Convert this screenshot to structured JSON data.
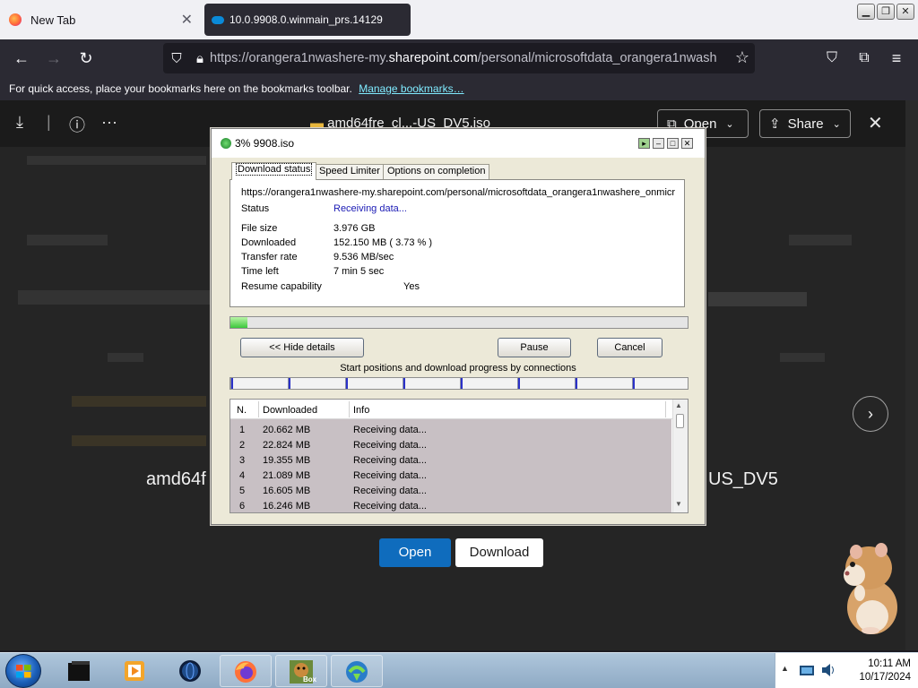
{
  "browser": {
    "tabs": [
      {
        "label": "New Tab"
      },
      {
        "label": "10.0.9908.0.winmain_prs.14129"
      }
    ],
    "url": {
      "prefix": "https://orangera1nwashere-my.",
      "domain": "sharepoint.com",
      "suffix": "/personal/microsoftdata_orangera1nwashere_"
    },
    "bookmarks_bar": {
      "text": "For quick access, place your bookmarks here on the bookmarks toolbar.",
      "link": "Manage bookmarks…"
    },
    "window_controls": [
      "minimize",
      "restore",
      "close"
    ]
  },
  "viewer": {
    "file_title": "amd64fre_cl...-US_DV5.iso",
    "open_label": "Open",
    "share_label": "Share",
    "center_filename_left": "amd64f",
    "center_filename_right": "US_DV5",
    "open_button": "Open",
    "download_button": "Download"
  },
  "idm": {
    "title": "3% 9908.iso",
    "tabs": [
      "Download status",
      "Speed Limiter",
      "Options on completion"
    ],
    "url": "https://orangera1nwashere-my.sharepoint.com/personal/microsoftdata_orangera1nwashere_onmicrosoft",
    "status_label": "Status",
    "status_value": "Receiving data...",
    "fields": [
      {
        "label": "File size",
        "value": "3.976  GB"
      },
      {
        "label": "Downloaded",
        "value": "152.150  MB  ( 3.73 % )"
      },
      {
        "label": "Transfer rate",
        "value": "9.536  MB/sec"
      },
      {
        "label": "Time left",
        "value": "7 min 5 sec"
      },
      {
        "label": "Resume capability",
        "value": "Yes"
      }
    ],
    "progress_percent": 3.73,
    "hide_details_label": "<< Hide details",
    "pause_label": "Pause",
    "cancel_label": "Cancel",
    "connections_caption": "Start positions and download progress by connections",
    "table_headers": [
      "N.",
      "Downloaded",
      "Info"
    ],
    "connections": [
      {
        "n": "1",
        "downloaded": "20.662  MB",
        "info": "Receiving data..."
      },
      {
        "n": "2",
        "downloaded": "22.824  MB",
        "info": "Receiving data..."
      },
      {
        "n": "3",
        "downloaded": "19.355  MB",
        "info": "Receiving data..."
      },
      {
        "n": "4",
        "downloaded": "21.089  MB",
        "info": "Receiving data..."
      },
      {
        "n": "5",
        "downloaded": "16.605  MB",
        "info": "Receiving data..."
      },
      {
        "n": "6",
        "downloaded": "16.246  MB",
        "info": "Receiving data..."
      }
    ]
  },
  "taskbar": {
    "time": "10:11 AM",
    "date": "10/17/2024",
    "box_label": "Box"
  },
  "colors": {
    "browser_chrome": "#2b2a33",
    "accent_link": "#80ebff",
    "open_button": "#0f6cbd",
    "idm_progress": "#3dc83d",
    "connection_row_bg": "#c8c0c4"
  }
}
